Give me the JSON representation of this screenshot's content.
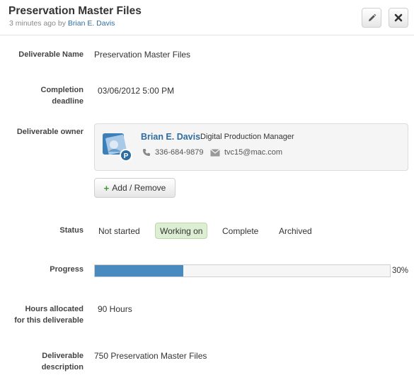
{
  "header": {
    "title": "Preservation Master Files",
    "time_ago": "3 minutes ago by",
    "author": "Brian E. Davis"
  },
  "toolbar": {
    "edit_icon": "pencil-icon",
    "close_icon": "close-icon"
  },
  "fields": {
    "deliverable_name": {
      "label": "Deliverable Name",
      "value": "Preservation Master Files"
    },
    "completion_deadline": {
      "label_line1": "Completion",
      "label_line2": "deadline",
      "value": "03/06/2012 5:00 PM"
    },
    "owner": {
      "label": "Deliverable owner",
      "name": "Brian E. Davis",
      "role": "Digital Production Manager",
      "phone": "336-684-9879",
      "email": "tvc15@mac.com",
      "phone_icon": "phone-icon",
      "email_icon": "mail-icon"
    },
    "add_remove_label": "Add / Remove",
    "status": {
      "label": "Status",
      "options": [
        "Not started",
        "Working on",
        "Complete",
        "Archived"
      ],
      "selected": "Working on"
    },
    "progress": {
      "label": "Progress",
      "percent": 30,
      "percent_label": "30%"
    },
    "hours": {
      "label_line1": "Hours allocated",
      "label_line2": "for this deliverable",
      "value": "90 Hours"
    },
    "description": {
      "label_line1": "Deliverable",
      "label_line2": "description",
      "value": "750 Preservation Master Files"
    }
  },
  "colors": {
    "link": "#2f6c9f",
    "progress_fill": "#4a8bbf",
    "status_active_bg": "#dcefd3",
    "add_plus": "#3a9a2a"
  }
}
